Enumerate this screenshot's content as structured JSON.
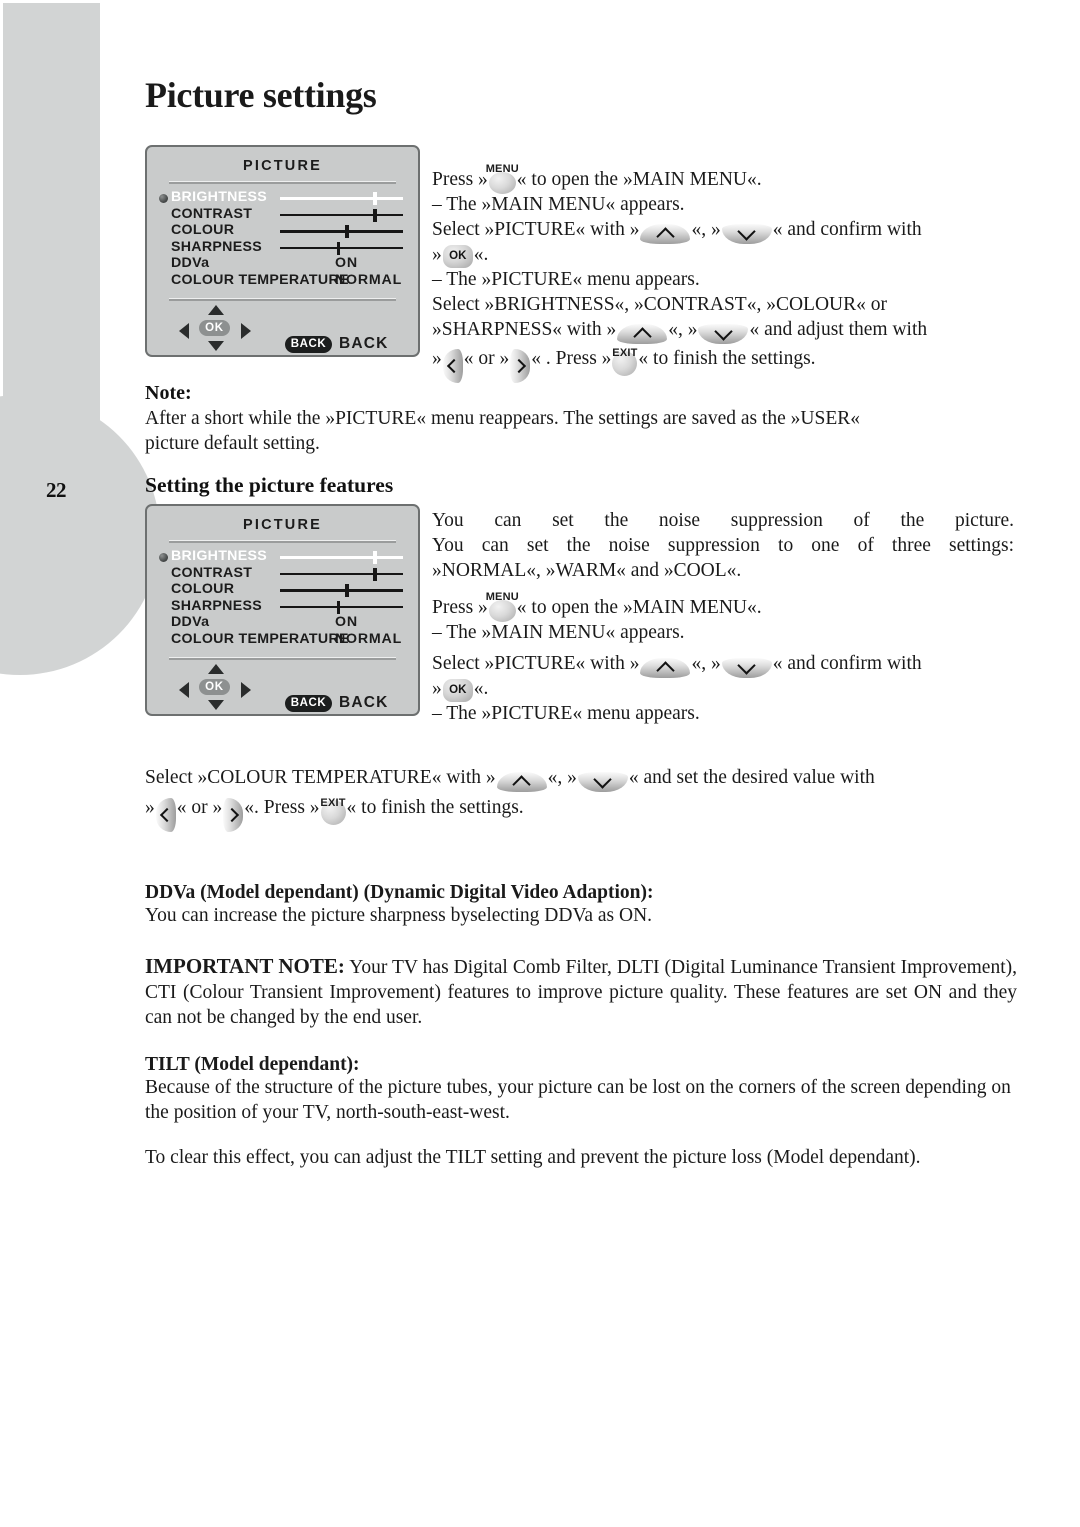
{
  "page": {
    "number": "22",
    "title": "Picture settings"
  },
  "osd_menu": {
    "title": "PICTURE",
    "rows": [
      {
        "label": "BRIGHTNESS",
        "type": "slider",
        "selected": true,
        "position_pct": 76
      },
      {
        "label": "CONTRAST",
        "type": "slider",
        "selected": false,
        "position_pct": 76
      },
      {
        "label": "COLOUR",
        "type": "slider",
        "selected": false,
        "position_pct": 53
      },
      {
        "label": "SHARPNESS",
        "type": "slider",
        "selected": false,
        "position_pct": 46
      },
      {
        "label": "DDVa",
        "type": "value",
        "selected": false,
        "value": "ON"
      },
      {
        "label": "COLOUR TEMPERATURE",
        "type": "value",
        "selected": false,
        "value": "NORMAL"
      }
    ],
    "nav": {
      "ok_label": "OK",
      "back_pill_label": "BACK",
      "back_word": "BACK"
    }
  },
  "keys": {
    "menu_cap": "MENU",
    "exit_cap": "EXIT",
    "ok_cap": "OK"
  },
  "section_1": {
    "line_1_a": "Press »",
    "line_1_b": "« to open the »MAIN MENU«.",
    "line_2": "– The »MAIN MENU« appears.",
    "line_3_a": "Select »PICTURE« with »",
    "line_3_b": "«, »",
    "line_3_c": "« and confirm with",
    "line_4_a": "»",
    "line_4_b": "«.",
    "line_5": "– The »PICTURE« menu appears.",
    "line_6": "Select »BRIGHTNESS«, »CONTRAST«, »COLOUR« or",
    "line_7_a": "»SHARPNESS« with »",
    "line_7_b": "«, »",
    "line_7_c": "« and adjust them with",
    "line_8_a": "»",
    "line_8_b": "« or »",
    "line_8_c": "« . Press »",
    "line_8_d": "« to finish the settings."
  },
  "note": {
    "heading": "Note:",
    "line_1": "After a short while the »PICTURE« menu reappears. The settings are saved as the »USER«",
    "line_2": "picture default setting."
  },
  "section_2": {
    "heading": "Setting the picture features",
    "line_1": "You can set the noise suppression of the picture.",
    "line_2": "You can set the noise suppression to one of three settings:",
    "line_3": "»NORMAL«, »WARM« and »COOL«.",
    "line_4_a": "Press »",
    "line_4_b": "« to open the »MAIN MENU«.",
    "line_5": "– The »MAIN MENU« appears.",
    "line_6_a": "Select »PICTURE« with »",
    "line_6_b": "«, »",
    "line_6_c": "« and confirm with",
    "line_7_a": "»",
    "line_7_b": "«.",
    "line_8": "– The »PICTURE« menu appears."
  },
  "section_3": {
    "line_1_a": "Select  »COLOUR TEMPERATURE« with  »",
    "line_1_b": "«, »",
    "line_1_c": "« and  set the  desired value with",
    "line_2_a": "»",
    "line_2_b": "« or »",
    "line_2_c": "«. Press »",
    "line_2_d": "« to finish the settings."
  },
  "ddva_section": {
    "heading": "DDVa (Model dependant) (Dynamic Digital Video Adaption):",
    "body": "You can increase the picture sharpness byselecting DDVa as ON."
  },
  "important_note": {
    "label": "IMPORTANT NOTE:",
    "body": " Your TV has Digital Comb Filter, DLTI (Digital Luminance Transient Improvement), CTI (Colour Transient Improvement) features  to improve picture quality. These features are set ON and they can not be changed by the end user."
  },
  "tilt_section": {
    "heading": "TILT (Model dependant):",
    "body_1": "Because of the structure of the picture tubes, your picture can be lost on the corners of the screen depending on the position of your TV, north-south-east-west.",
    "body_2": "To clear this effect, you can adjust the TILT setting and prevent the picture loss  (Model dependant)."
  }
}
